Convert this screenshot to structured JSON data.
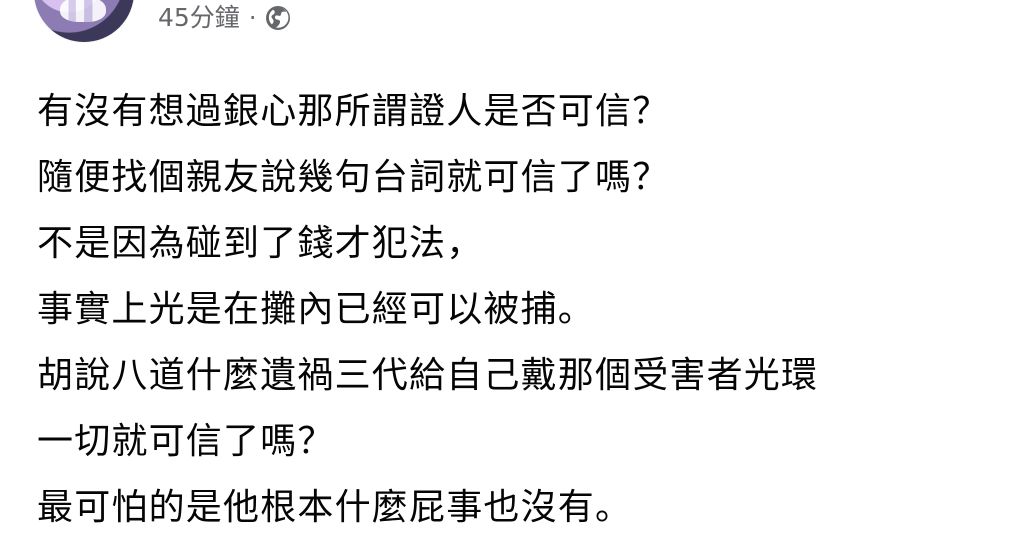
{
  "post": {
    "time": "45分鐘",
    "separator": "·",
    "privacy_icon": "globe-icon",
    "lines": [
      "有沒有想過銀心那所謂證人是否可信？",
      "隨便找個親友說幾句台詞就可信了嗎？",
      "不是因為碰到了錢才犯法，",
      "事實上光是在攤內已經可以被捕。",
      "胡說八道什麼遺禍三代給自己戴那個受害者光環",
      "一切就可信了嗎？",
      "最可怕的是他根本什麼屁事也沒有。"
    ]
  },
  "colors": {
    "text": "#050505",
    "meta": "#65676b",
    "background": "#ffffff"
  }
}
